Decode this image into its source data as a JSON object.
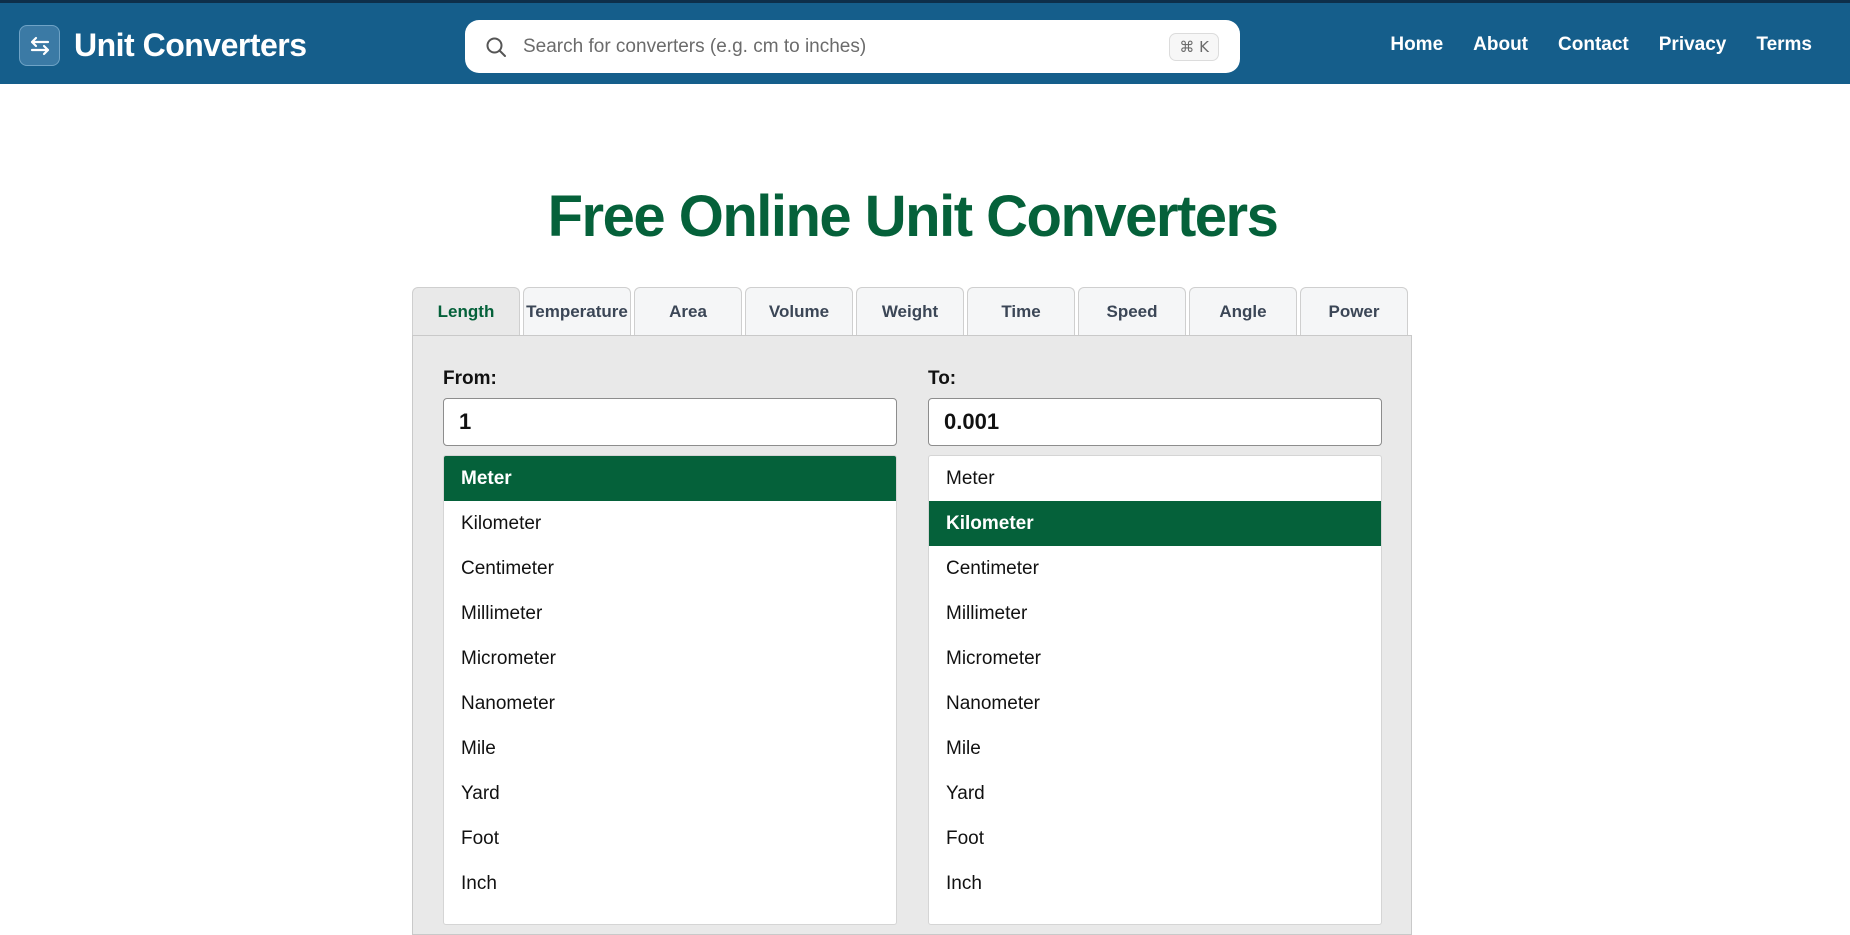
{
  "header": {
    "brand_title": "Unit Converters",
    "brand_icon": "swap-arrows-icon",
    "search_placeholder": "Search for converters (e.g. cm to inches)",
    "search_shortcut": "⌘ K",
    "nav": [
      "Home",
      "About",
      "Contact",
      "Privacy",
      "Terms"
    ]
  },
  "colors": {
    "header_bg": "#155e8b",
    "accent_green": "#05613a",
    "panel_bg": "#e9e9e9"
  },
  "main": {
    "title": "Free Online Unit Converters",
    "tabs": [
      "Length",
      "Temperature",
      "Area",
      "Volume",
      "Weight",
      "Time",
      "Speed",
      "Angle",
      "Power"
    ],
    "active_tab": "Length",
    "from": {
      "label": "From:",
      "value": "1",
      "units": [
        "Meter",
        "Kilometer",
        "Centimeter",
        "Millimeter",
        "Micrometer",
        "Nanometer",
        "Mile",
        "Yard",
        "Foot",
        "Inch"
      ],
      "selected": "Meter"
    },
    "to": {
      "label": "To:",
      "value": "0.001",
      "units": [
        "Meter",
        "Kilometer",
        "Centimeter",
        "Millimeter",
        "Micrometer",
        "Nanometer",
        "Mile",
        "Yard",
        "Foot",
        "Inch"
      ],
      "selected": "Kilometer"
    }
  }
}
